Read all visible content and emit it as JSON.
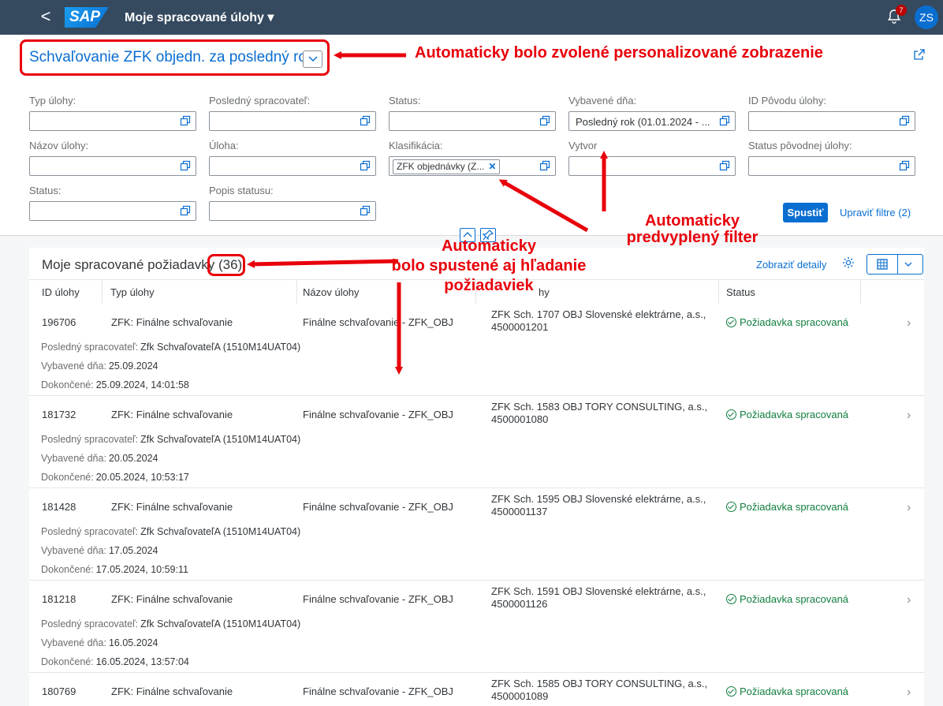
{
  "shell": {
    "back": "<",
    "logo": "SAP",
    "title": "Moje spracované úlohy ▾",
    "notif_count": "7",
    "avatar": "ZS"
  },
  "variant": {
    "name": "Schvaľovanie ZFK objedn. za posledný rok"
  },
  "filters": [
    {
      "label": "Typ úlohy:",
      "value": ""
    },
    {
      "label": "Posledný spracovateľ:",
      "value": ""
    },
    {
      "label": "Status:",
      "value": ""
    },
    {
      "label": "Vybavené dňa:",
      "value": "Posledný rok (01.01.2024 - ..."
    },
    {
      "label": "ID Pôvodu úlohy:",
      "value": ""
    },
    {
      "label": "Názov úlohy:",
      "value": ""
    },
    {
      "label": "Úloha:",
      "value": ""
    },
    {
      "label": "Klasifikácia:",
      "token": "ZFK objednávky (Z..."
    },
    {
      "label": "Vytvor",
      "value": ""
    },
    {
      "label": "Status pôvodnej úlohy:",
      "value": ""
    },
    {
      "label": "Status:",
      "value": ""
    },
    {
      "label": "Popis statusu:",
      "value": ""
    }
  ],
  "actions": {
    "go": "Spustiť",
    "adapt": "Upraviť filtre (2)"
  },
  "table": {
    "title": "Moje spracované požiadavky",
    "count": "(36)",
    "details": "Zobraziť detaily",
    "columns": [
      "ID úlohy",
      "Typ úlohy",
      "Názov úlohy",
      "hy",
      "Status"
    ],
    "attr_labels": {
      "processor": "Posledný spracovateľ:",
      "done_on": "Vybavené dňa:",
      "completed": "Dokončené:"
    },
    "rows": [
      {
        "id": "196706",
        "type": "ZFK: Finálne schvaľovanie",
        "name": "Finálne schvaľovanie - ZFK_OBJ",
        "desc": "ZFK Sch. 1707 OBJ Slovenské elektrárne, a.s., 4500001201",
        "status": "Požiadavka spracovaná",
        "processor": "Zfk SchvaľovateľA (1510M14UAT04)",
        "done_on": "25.09.2024",
        "completed": "25.09.2024, 14:01:58"
      },
      {
        "id": "181732",
        "type": "ZFK: Finálne schvaľovanie",
        "name": "Finálne schvaľovanie - ZFK_OBJ",
        "desc": "ZFK Sch. 1583 OBJ TORY CONSULTING, a.s., 4500001080",
        "status": "Požiadavka spracovaná",
        "processor": "Zfk SchvaľovateľA (1510M14UAT04)",
        "done_on": "20.05.2024",
        "completed": "20.05.2024, 10:53:17"
      },
      {
        "id": "181428",
        "type": "ZFK: Finálne schvaľovanie",
        "name": "Finálne schvaľovanie - ZFK_OBJ",
        "desc": "ZFK Sch. 1595 OBJ Slovenské elektrárne, a.s., 4500001137",
        "status": "Požiadavka spracovaná",
        "processor": "Zfk SchvaľovateľA (1510M14UAT04)",
        "done_on": "17.05.2024",
        "completed": "17.05.2024, 10:59:11"
      },
      {
        "id": "181218",
        "type": "ZFK: Finálne schvaľovanie",
        "name": "Finálne schvaľovanie - ZFK_OBJ",
        "desc": "ZFK Sch. 1591 OBJ Slovenské elektrárne, a.s., 4500001126",
        "status": "Požiadavka spracovaná",
        "processor": "Zfk SchvaľovateľA (1510M14UAT04)",
        "done_on": "16.05.2024",
        "completed": "16.05.2024, 13:57:04"
      },
      {
        "id": "180769",
        "type": "ZFK: Finálne schvaľovanie",
        "name": "Finálne schvaľovanie - ZFK_OBJ",
        "desc": "ZFK Sch. 1585 OBJ TORY CONSULTING, a.s., 4500001089",
        "status": "Požiadavka spracovaná"
      }
    ]
  },
  "annotations": {
    "variant": "Automaticky bolo zvolené personalizované zobrazenie",
    "filter": [
      "Automaticky",
      "predvyplený filter"
    ],
    "search": [
      "Automaticky",
      "bolo spustené aj hľadanie",
      "požiadaviek"
    ]
  }
}
